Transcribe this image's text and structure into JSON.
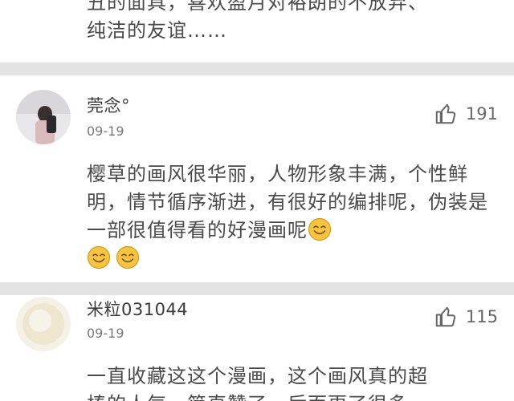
{
  "prev_comment": {
    "lines": [
      "丑的面具，喜欢盈月对裕朗的不放弃、",
      "纯洁的友谊……"
    ]
  },
  "comments": [
    {
      "username": "莞念°",
      "date": "09-19",
      "likes": "191",
      "text": "樱草的画风很华丽，人物形象丰满，个性鲜明，情节循序渐进，有很好的编排呢，伪装是一部很值得看的好漫画呢"
    },
    {
      "username": "米粒031044",
      "date": "09-19",
      "likes": "115",
      "text_lines": [
        "一直收藏这这个漫画，这个画风真的超",
        "棒的人气，简直赞了，后面更了很多"
      ]
    }
  ],
  "icons": {
    "like": "thumbs-up-icon",
    "emoji": "smiley-emoji"
  },
  "colors": {
    "separator": "#e3e3e3",
    "text": "#4a4a4a",
    "meta": "#777777",
    "emoji": "#f5c542"
  }
}
